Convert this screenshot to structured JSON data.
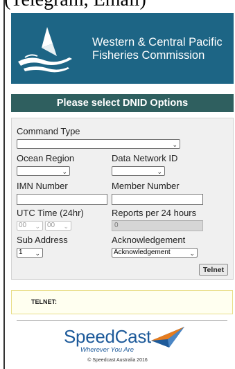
{
  "top_fragment": "(Telegram, Email)",
  "banner": {
    "org_line1": "Western & Central Pacific",
    "org_line2": "Fisheries Commission"
  },
  "heading": "Please select DNID Options",
  "form": {
    "command_type": {
      "label": "Command Type",
      "value": ""
    },
    "ocean_region": {
      "label": "Ocean Region",
      "value": ""
    },
    "data_network_id": {
      "label": "Data Network ID",
      "value": ""
    },
    "imn_number": {
      "label": "IMN Number",
      "value": ""
    },
    "member_number": {
      "label": "Member Number",
      "value": ""
    },
    "utc_time": {
      "label": "UTC Time (24hr)",
      "hour": "00",
      "minute": "00"
    },
    "reports_per_24": {
      "label": "Reports per 24 hours",
      "value": "0"
    },
    "sub_address": {
      "label": "Sub Address",
      "value": "1"
    },
    "acknowledgement": {
      "label": "Acknowledgement",
      "value": "Acknowledgement"
    },
    "telnet_button": "Telnet"
  },
  "result": {
    "label": "TELNET:"
  },
  "footer": {
    "brand": "SpeedCast",
    "tagline": "Wherever You Are",
    "copyright": "© Speedcast Australia 2016"
  },
  "colors": {
    "banner_bg": "#1d6585",
    "heading_bg": "#2f5f5f",
    "brand_blue": "#1d5a9a"
  }
}
